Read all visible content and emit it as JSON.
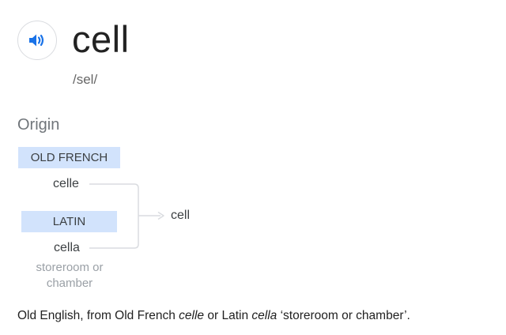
{
  "entry": {
    "word": "cell",
    "phonetic": "/sel/",
    "audio_icon": "speaker-volume-icon",
    "accent_color": "#1a73e8"
  },
  "origin": {
    "title": "Origin",
    "tag_color": "#d2e3fc",
    "line_color": "#dadce0",
    "branches": [
      {
        "language": "OLD FRENCH",
        "word": "celle"
      },
      {
        "language": "LATIN",
        "word": "cella",
        "gloss": "storeroom or chamber"
      }
    ],
    "result": "cell",
    "summary": {
      "part1": "Old English, from Old French ",
      "word1": "celle",
      "part2": " or Latin ",
      "word2": "cella",
      "part3": " ‘storeroom or chamber’."
    }
  }
}
